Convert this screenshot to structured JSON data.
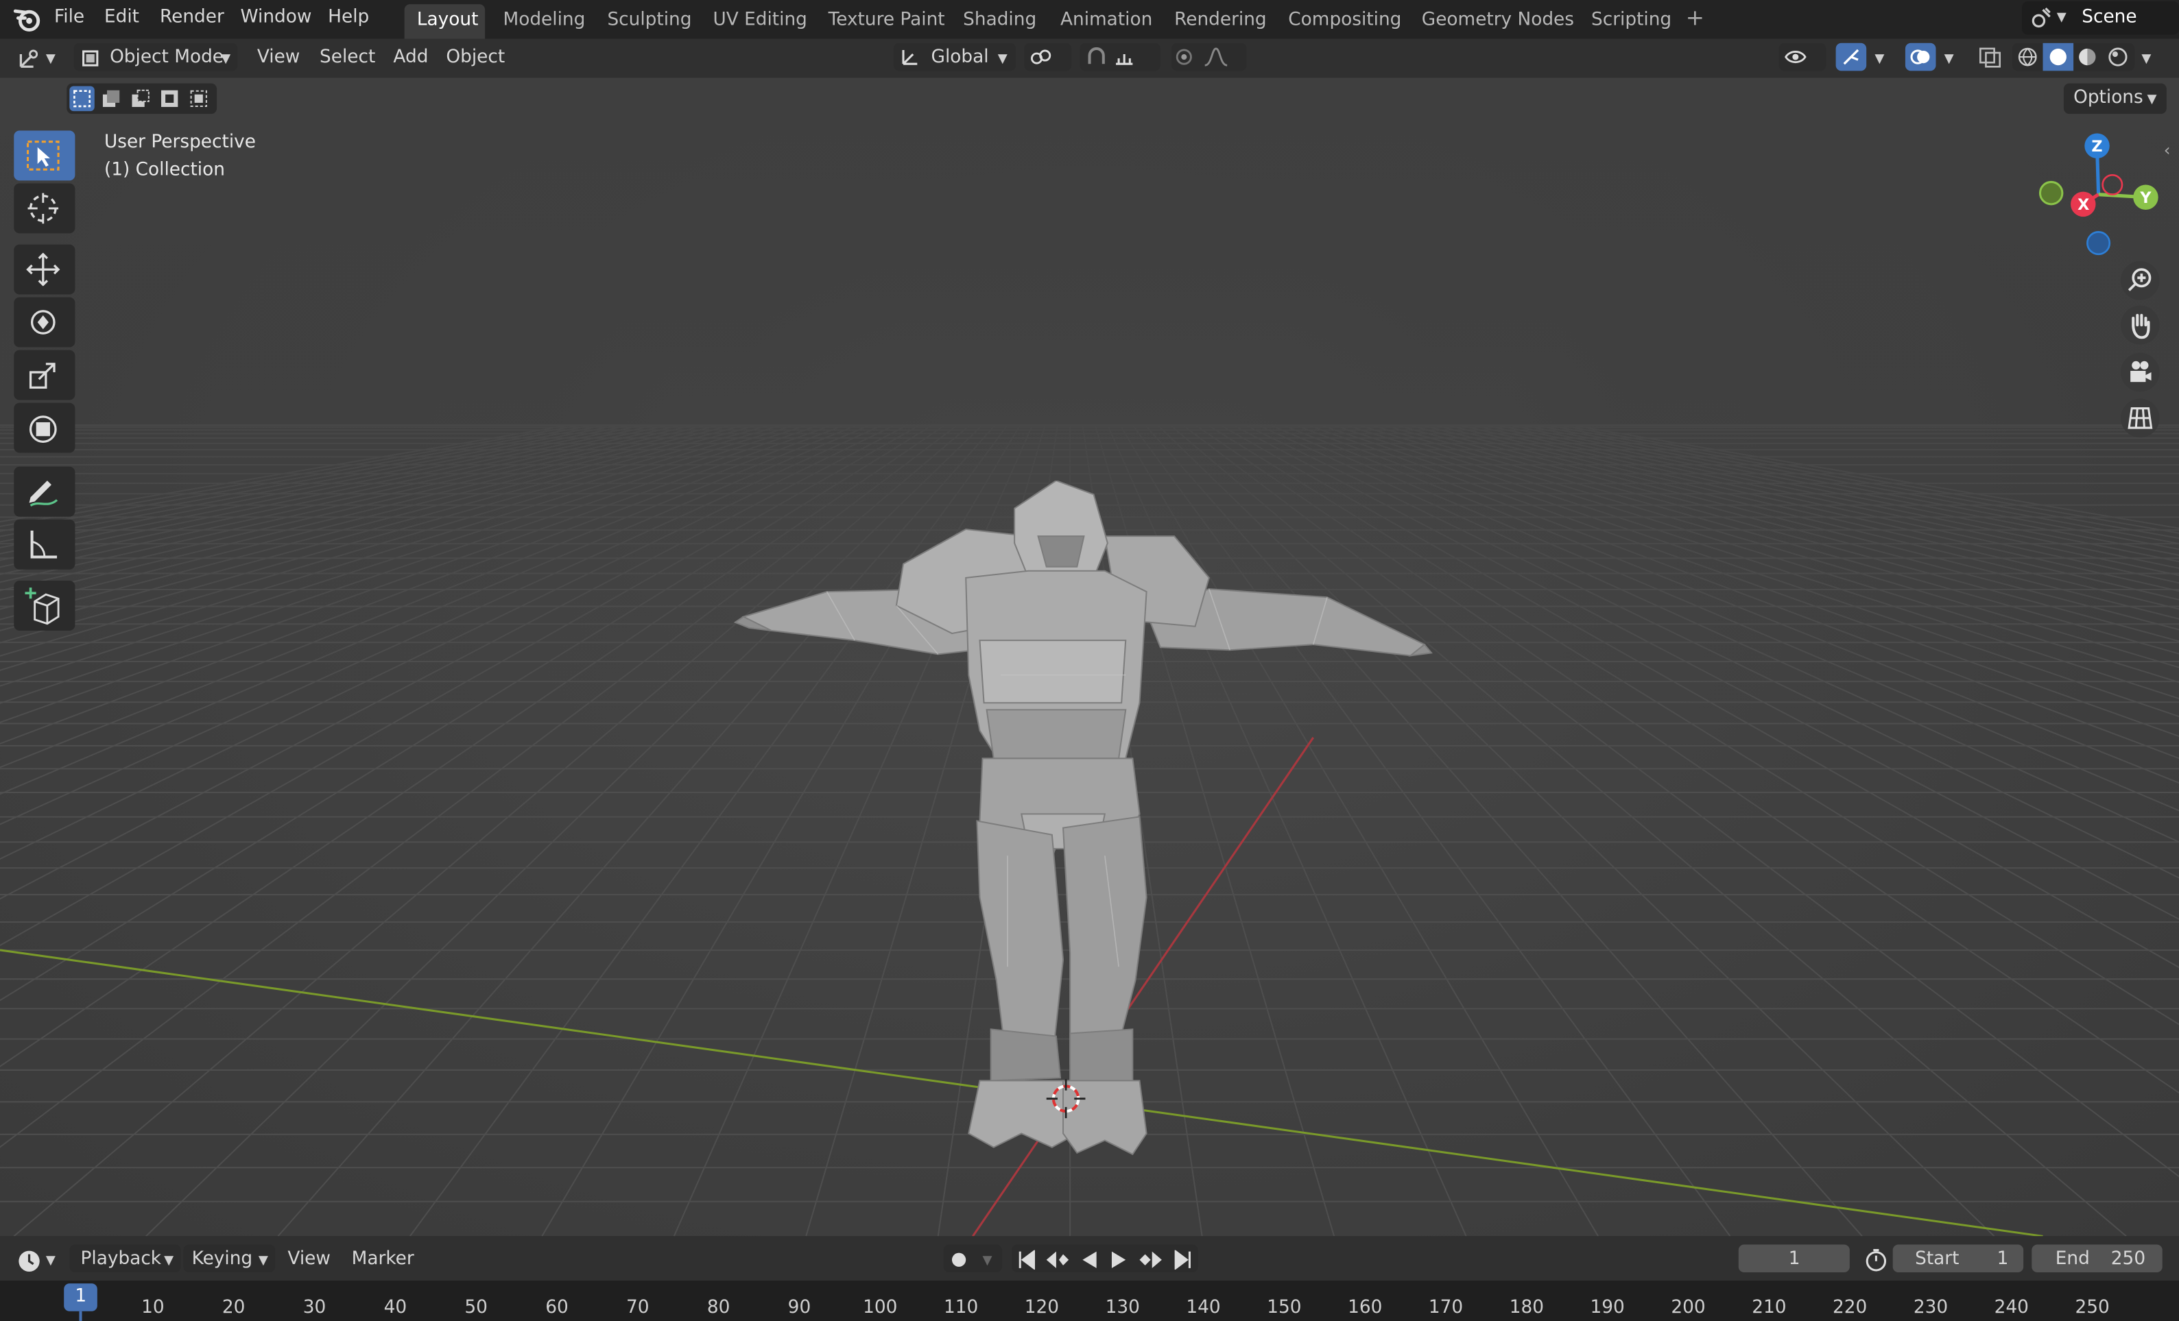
{
  "menu": [
    "File",
    "Edit",
    "Render",
    "Window",
    "Help"
  ],
  "workspaces": [
    "Layout",
    "Modeling",
    "Sculpting",
    "UV Editing",
    "Texture Paint",
    "Shading",
    "Animation",
    "Rendering",
    "Compositing",
    "Geometry Nodes",
    "Scripting"
  ],
  "active_workspace": "Layout",
  "scene_name": "Scene",
  "header": {
    "mode": "Object Mode",
    "menus": [
      "View",
      "Select",
      "Add",
      "Object"
    ],
    "transform_orientation": "Global",
    "options_label": "Options"
  },
  "viewport": {
    "overlay_line1": "User Perspective",
    "overlay_line2": "(1) Collection"
  },
  "gizmo": {
    "z": "Z",
    "y": "Y",
    "x": "X"
  },
  "timeline": {
    "menus": [
      "Playback",
      "Keying",
      "View",
      "Marker"
    ],
    "current_frame": "1",
    "start_label": "Start",
    "start_value": "1",
    "end_label": "End",
    "end_value": "250",
    "ruler_current": "1",
    "ruler_ticks": [
      "10",
      "20",
      "30",
      "40",
      "50",
      "60",
      "70",
      "80",
      "90",
      "100",
      "110",
      "120",
      "130",
      "140",
      "150",
      "160",
      "170",
      "180",
      "190",
      "200",
      "210",
      "220",
      "230",
      "240",
      "250"
    ]
  },
  "icons": [
    "blender-logo-icon",
    "editor-type-icon",
    "select-box-icon",
    "cursor-icon",
    "move-icon",
    "rotate-icon",
    "scale-icon",
    "transform-icon",
    "annotate-icon",
    "measure-icon",
    "add-cube-icon",
    "zoom-icon",
    "hand-icon",
    "camera-icon",
    "grid-icon",
    "play-icon",
    "record-icon",
    "stopwatch-icon"
  ],
  "colors": {
    "accent": "#4772b3",
    "x_axis": "#e8384f",
    "y_axis": "#8bc34a",
    "z_axis": "#2e7fd6"
  }
}
